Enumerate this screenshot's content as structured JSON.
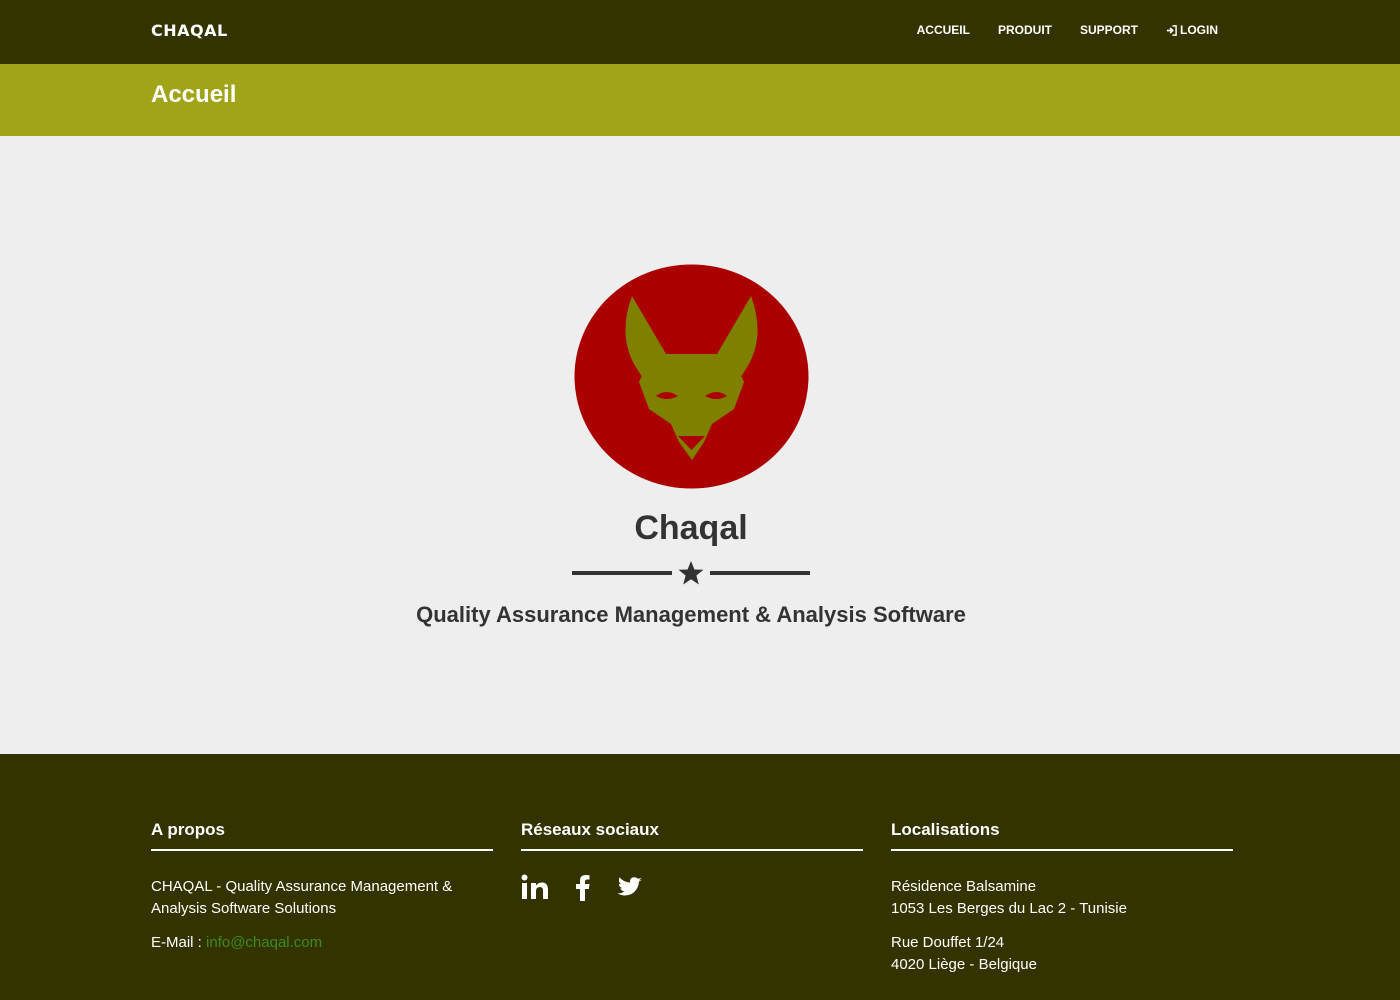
{
  "brand": "CHAQAL",
  "nav": {
    "home": "ACCUEIL",
    "product": "PRODUIT",
    "support": "SUPPORT",
    "login": "LOGIN"
  },
  "page_title": "Accueil",
  "hero": {
    "title": "Chaqal",
    "subtitle": "Quality Assurance Management & Analysis Software"
  },
  "footer": {
    "about": {
      "heading": "A propos",
      "description": "CHAQAL - Quality Assurance Management & Analysis Software Solutions",
      "email_label": "E-Mail :",
      "email": "info@chaqal.com"
    },
    "social": {
      "heading": "Réseaux sociaux",
      "icons": [
        "linkedin-icon",
        "facebook-icon",
        "twitter-icon"
      ]
    },
    "locations": {
      "heading": "Localisations",
      "addr1_line1": "Résidence Balsamine",
      "addr1_line2": "1053 Les Berges du Lac 2 - Tunisie",
      "addr2_line1": "Rue Douffet 1/24",
      "addr2_line2": "4020 Liège - Belgique"
    }
  },
  "colors": {
    "navbar": "#333300",
    "title_bar": "#a0a419",
    "logo_circle": "#aa0000",
    "logo_jackal": "#808000",
    "link": "#3d8b1a"
  }
}
